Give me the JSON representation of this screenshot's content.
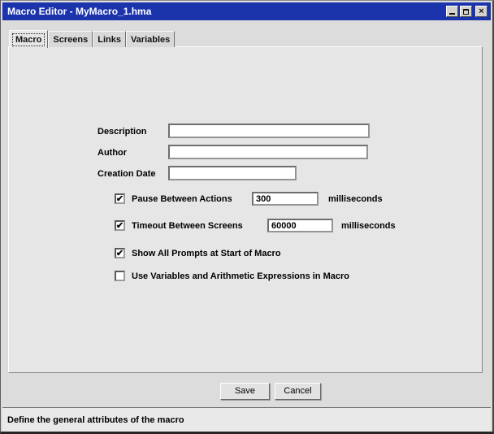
{
  "window": {
    "title": "Macro Editor - MyMacro_1.hma",
    "controls": {
      "close_glyph": "×"
    },
    "colors": {
      "titlebar": "#1b33ab",
      "title_text": "#ffffff",
      "panel": "#e6e6e6"
    }
  },
  "tabs": [
    {
      "label": "Macro",
      "selected": true
    },
    {
      "label": "Screens",
      "selected": false
    },
    {
      "label": "Links",
      "selected": false
    },
    {
      "label": "Variables",
      "selected": false
    }
  ],
  "form": {
    "fields": [
      {
        "label": "Description",
        "value": ""
      },
      {
        "label": "Author",
        "value": ""
      },
      {
        "label": "Creation Date",
        "value": ""
      }
    ],
    "options": [
      {
        "label": "Pause Between Actions",
        "checked": true,
        "glyph": "✔",
        "value": "300",
        "unit": "milliseconds"
      },
      {
        "label": "Timeout Between Screens",
        "checked": true,
        "glyph": "✔",
        "value": "60000",
        "unit": "milliseconds"
      },
      {
        "label": "Show All Prompts at Start of Macro",
        "checked": true,
        "glyph": "✔"
      },
      {
        "label": "Use Variables and Arithmetic Expressions in Macro",
        "checked": false,
        "glyph": ""
      }
    ]
  },
  "buttons": {
    "save": "Save",
    "cancel": "Cancel"
  },
  "statusbar": {
    "text": "Define the general attributes of the macro"
  }
}
